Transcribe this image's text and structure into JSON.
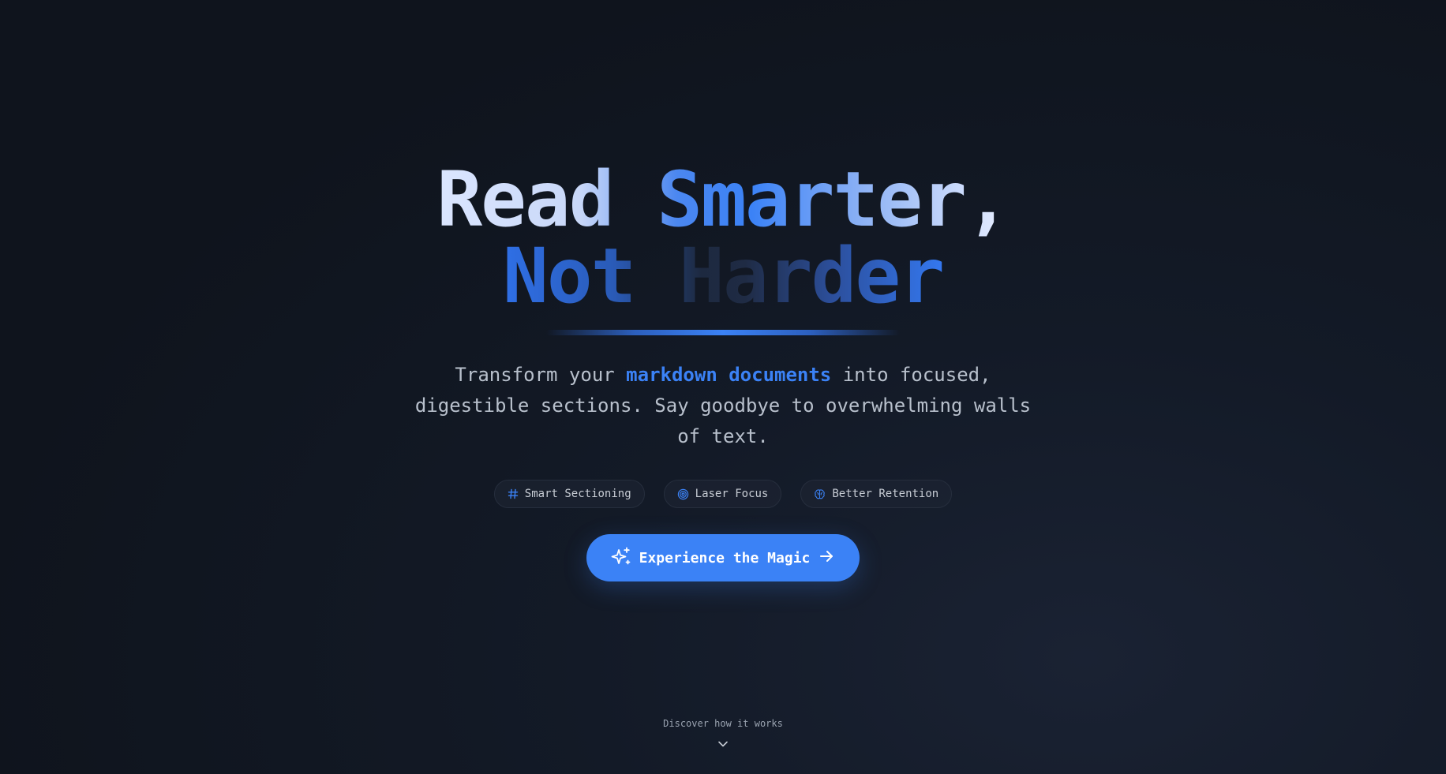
{
  "hero": {
    "headline_line1": {
      "part1": "Read ",
      "part2": "Smarter,"
    },
    "headline_line2": {
      "part1": "Not ",
      "part2": "Harder"
    },
    "subtitle": {
      "before": "Transform your ",
      "highlight": "markdown documents",
      "after": " into focused, digestible sections. Say goodbye to overwhelming walls of text."
    },
    "features": [
      {
        "label": "Smart Sectioning",
        "icon": "hash-icon"
      },
      {
        "label": "Laser Focus",
        "icon": "target-icon"
      },
      {
        "label": "Better Retention",
        "icon": "brain-icon"
      }
    ],
    "cta_label": "Experience the Magic",
    "discover_label": "Discover how it works"
  },
  "colors": {
    "accent": "#3b82f6",
    "background": "#131a27",
    "muted_text": "#b8c0cc"
  }
}
